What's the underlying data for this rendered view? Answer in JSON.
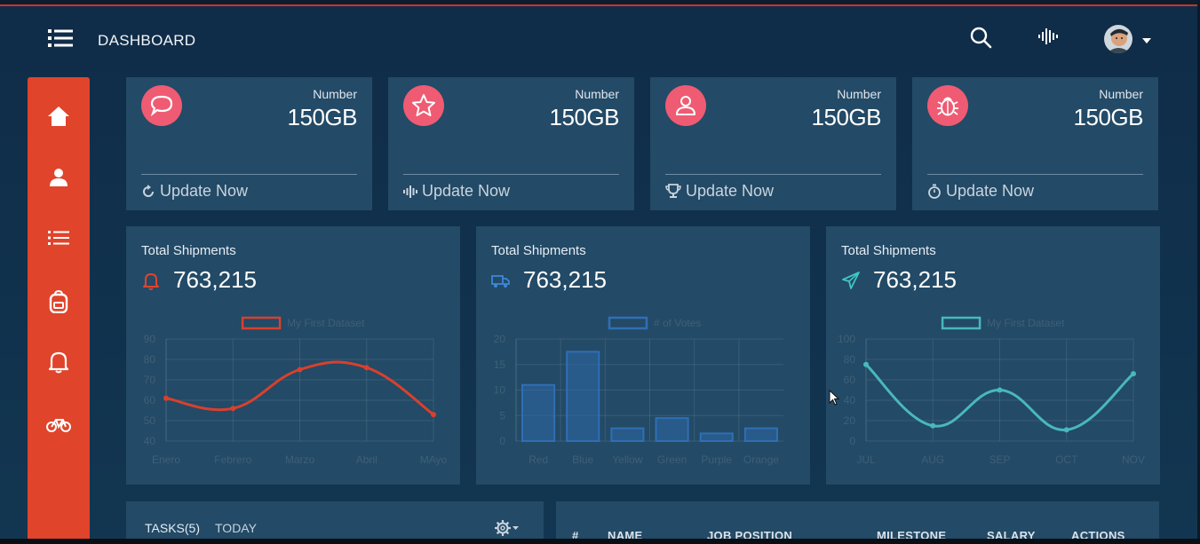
{
  "header": {
    "title": "DASHBOARD",
    "icons": [
      "menu-icon",
      "search-icon",
      "waveform-icon",
      "avatar",
      "chevron-down-icon"
    ]
  },
  "sidebar": {
    "items": [
      {
        "icon": "home-icon"
      },
      {
        "icon": "user-icon"
      },
      {
        "icon": "list-icon"
      },
      {
        "icon": "backpack-icon"
      },
      {
        "icon": "bell-icon"
      },
      {
        "icon": "bicycle-icon"
      }
    ],
    "color": "#e0442b"
  },
  "stats": [
    {
      "label": "Number",
      "value": "150GB",
      "footer": "Update Now",
      "icon": "chat-bubble-icon",
      "footer_icon": "refresh-icon"
    },
    {
      "label": "Number",
      "value": "150GB",
      "footer": "Update Now",
      "icon": "star-icon",
      "footer_icon": "waveform-icon"
    },
    {
      "label": "Number",
      "value": "150GB",
      "footer": "Update Now",
      "icon": "user-circle-icon",
      "footer_icon": "trophy-icon"
    },
    {
      "label": "Number",
      "value": "150GB",
      "footer": "Update Now",
      "icon": "bug-icon",
      "footer_icon": "stopwatch-icon"
    }
  ],
  "shipments": [
    {
      "title": "Total Shipments",
      "value": "763,215",
      "icon": "bell-icon",
      "icon_color": "#e0442b"
    },
    {
      "title": "Total Shipments",
      "value": "763,215",
      "icon": "truck-icon",
      "icon_color": "#3d86d8"
    },
    {
      "title": "Total Shipments",
      "value": "763,215",
      "icon": "send-icon",
      "icon_color": "#3fc7c0"
    }
  ],
  "chart_data": [
    {
      "type": "line",
      "categories": [
        "Enero",
        "Febrero",
        "Marzo",
        "Abril",
        "MAyo"
      ],
      "series": [
        {
          "name": "My First Dataset",
          "values": [
            61,
            56,
            75,
            76,
            53
          ],
          "color": "#d9402c"
        }
      ],
      "yticks": [
        40,
        50,
        60,
        70,
        80,
        90
      ],
      "ylim": [
        40,
        90
      ],
      "smooth": true,
      "legend": "top-center"
    },
    {
      "type": "bar",
      "categories": [
        "Red",
        "Blue",
        "Yellow",
        "Green",
        "Purple",
        "Orange"
      ],
      "series": [
        {
          "name": "# of Votes",
          "values": [
            11,
            17.5,
            2.5,
            4.5,
            1.5,
            2.5
          ],
          "color": "#2f6fb5"
        }
      ],
      "yticks": [
        0,
        5,
        10,
        15,
        20
      ],
      "ylim": [
        0,
        20
      ],
      "legend": "top-center"
    },
    {
      "type": "line",
      "categories": [
        "JUL",
        "AUG",
        "SEP",
        "OCT",
        "NOV"
      ],
      "series": [
        {
          "name": "My First Dataset",
          "values": [
            75,
            15,
            50,
            11,
            66
          ],
          "color": "#48b8bf"
        }
      ],
      "yticks": [
        0,
        20,
        40,
        60,
        80,
        100
      ],
      "ylim": [
        0,
        100
      ],
      "smooth": true,
      "legend": "top-center"
    }
  ],
  "tasks": {
    "title": "TASKS(5)",
    "tab": "TODAY"
  },
  "table": {
    "headers": [
      "#",
      "NAME",
      "JOB POSITION",
      "MILESTONE",
      "SALARY",
      "ACTIONS"
    ]
  },
  "colors": {
    "accent": "#e0442b",
    "card": "#234a66",
    "stat_icon": "#ef5b73",
    "background": "#0f2c48"
  }
}
